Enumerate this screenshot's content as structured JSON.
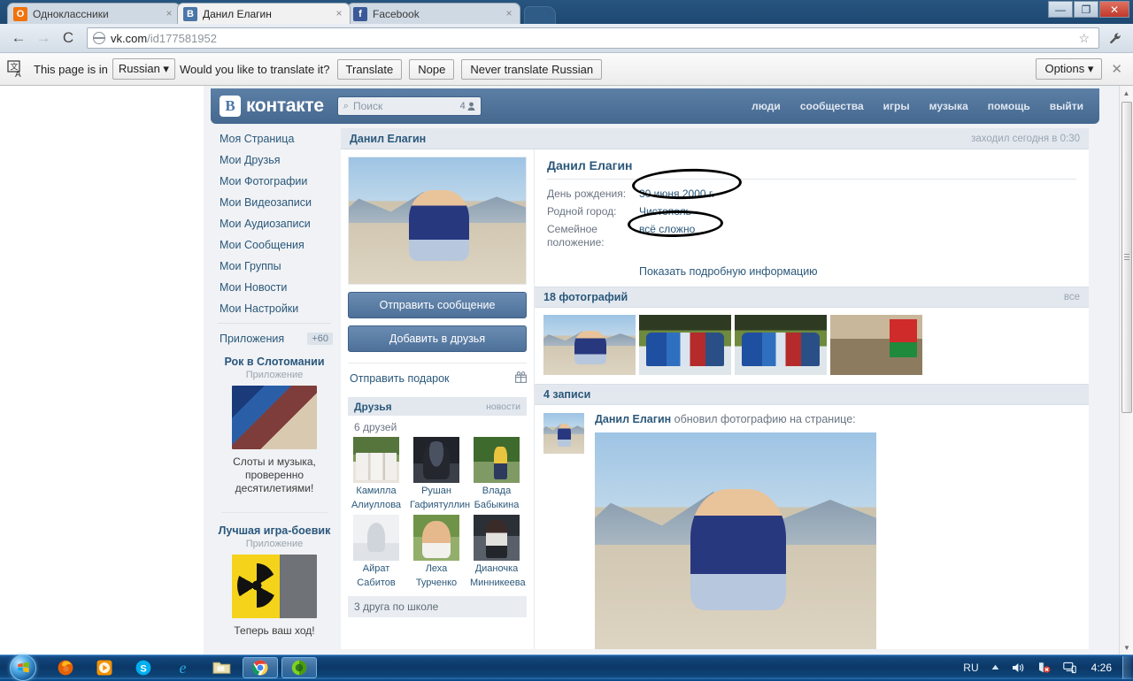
{
  "browser": {
    "tabs": [
      {
        "title": "Одноклассники",
        "favicon_name": "odnoklassniki-favicon",
        "favicon_letter": "О",
        "favicon_color": "#f2720c",
        "active": false
      },
      {
        "title": "Данил Елагин",
        "favicon_name": "vk-favicon",
        "favicon_letter": "B",
        "favicon_color": "#4a76a8",
        "active": true
      },
      {
        "title": "Facebook",
        "favicon_name": "facebook-favicon",
        "favicon_letter": "f",
        "favicon_color": "#3b5998",
        "active": false
      }
    ],
    "tab_close_glyph": "×",
    "nav": {
      "back": "←",
      "forward": "→",
      "reload": "C"
    },
    "url_host": "vk.com",
    "url_path": "/id177581952",
    "star_glyph": "☆",
    "wrench_glyph": "🔧",
    "window_controls": {
      "minimize": "—",
      "restore": "❐",
      "close": "✕"
    }
  },
  "translate_bar": {
    "prefix": "This page is in",
    "language": "Russian",
    "question": "Would you like to translate it?",
    "translate_label": "Translate",
    "nope_label": "Nope",
    "never_label": "Never translate Russian",
    "options_label": "Options",
    "dropdown_caret": "▾",
    "close_glyph": "✕"
  },
  "vk": {
    "logo_mark": "В",
    "logo_text": "контакте",
    "search_placeholder": "Поиск",
    "search_count": "4",
    "search_icon_glyph": "⌕",
    "person_glyph": "👤",
    "topnav": [
      "люди",
      "сообщества",
      "игры",
      "музыка",
      "помощь",
      "выйти"
    ],
    "sidebar": [
      "Моя Страница",
      "Мои Друзья",
      "Мои Фотографии",
      "Мои Видеозаписи",
      "Мои Аудиозаписи",
      "Мои Сообщения",
      "Мои Группы",
      "Мои Новости",
      "Мои Настройки"
    ],
    "apps_label": "Приложения",
    "apps_badge": "+60",
    "ads": [
      {
        "title": "Рок в Слотомании",
        "subtitle": "Приложение",
        "text": "Слоты и музыка, проверенно десятилетиями!",
        "image_name": "rock-slots-banner"
      },
      {
        "title": "Лучшая игра-боевик",
        "subtitle": "Приложение",
        "text": "Теперь ваш ход!",
        "image_name": "radioactive-game-banner"
      }
    ],
    "page_bar": {
      "name": "Данил Елагин",
      "status": "заходил сегодня в 0:30"
    },
    "profile": {
      "name": "Данил Елагин",
      "avatar_name": "profile-avatar-photo",
      "fields": [
        {
          "label": "День рождения:",
          "value": "30 июня 2000 г.",
          "circled": true
        },
        {
          "label": "Родной город:",
          "value": "Чистополь",
          "circled": false
        },
        {
          "label": "Семейное положение:",
          "value": "всё сложно",
          "circled": true
        }
      ],
      "more_link": "Показать подробную информацию"
    },
    "actions": {
      "message_label": "Отправить сообщение",
      "add_friend_label": "Добавить в друзья",
      "gift_label": "Отправить подарок",
      "gift_icon_glyph": "🎁"
    },
    "friends_block": {
      "title": "Друзья",
      "news_label": "новости",
      "count_label": "6 друзей",
      "school_label": "3 друга по школе",
      "friends": [
        {
          "first": "Камилла",
          "last": "Алиуллова",
          "photo_name": "friend-photo-kamilla"
        },
        {
          "first": "Рушан",
          "last": "Гафиятуллин",
          "photo_name": "friend-photo-rushan"
        },
        {
          "first": "Влада",
          "last": "Бабыкина",
          "photo_name": "friend-photo-vlada"
        },
        {
          "first": "Айрат",
          "last": "Сабитов",
          "photo_name": "friend-photo-ayrat"
        },
        {
          "first": "Леха",
          "last": "Турченко",
          "photo_name": "friend-photo-leha"
        },
        {
          "first": "Дианочка",
          "last": "Минникеева",
          "photo_name": "friend-photo-dianochka"
        }
      ]
    },
    "photos_block": {
      "title": "18 фотографий",
      "all_label": "все",
      "photos": [
        {
          "name": "photo-mountain-portrait"
        },
        {
          "name": "photo-team-blue-1"
        },
        {
          "name": "photo-team-blue-2"
        },
        {
          "name": "photo-flag-ceremony"
        }
      ]
    },
    "wall_block": {
      "title": "4 записи",
      "post": {
        "author": "Данил Елагин",
        "action": " обновил фотографию на странице:",
        "avatar_name": "wall-post-avatar",
        "photo_name": "wall-post-photo"
      }
    }
  },
  "taskbar": {
    "start_glyph": "⊞",
    "items": [
      {
        "name": "firefox",
        "glyph": "🦊",
        "active": false
      },
      {
        "name": "media-player",
        "glyph": "▶",
        "active": false
      },
      {
        "name": "skype",
        "glyph": "S",
        "active": false
      },
      {
        "name": "internet-explorer",
        "glyph": "e",
        "active": false
      },
      {
        "name": "file-explorer",
        "glyph": "🗀",
        "active": false
      },
      {
        "name": "chrome",
        "glyph": "◉",
        "active": true
      },
      {
        "name": "download-manager",
        "glyph": "◕",
        "active": true
      }
    ],
    "tray": {
      "language": "RU",
      "expand_glyph": "▲",
      "volume_glyph": "🔊",
      "security_glyph": "🛡",
      "network_glyph": "🖧",
      "clock": "4:26"
    }
  }
}
